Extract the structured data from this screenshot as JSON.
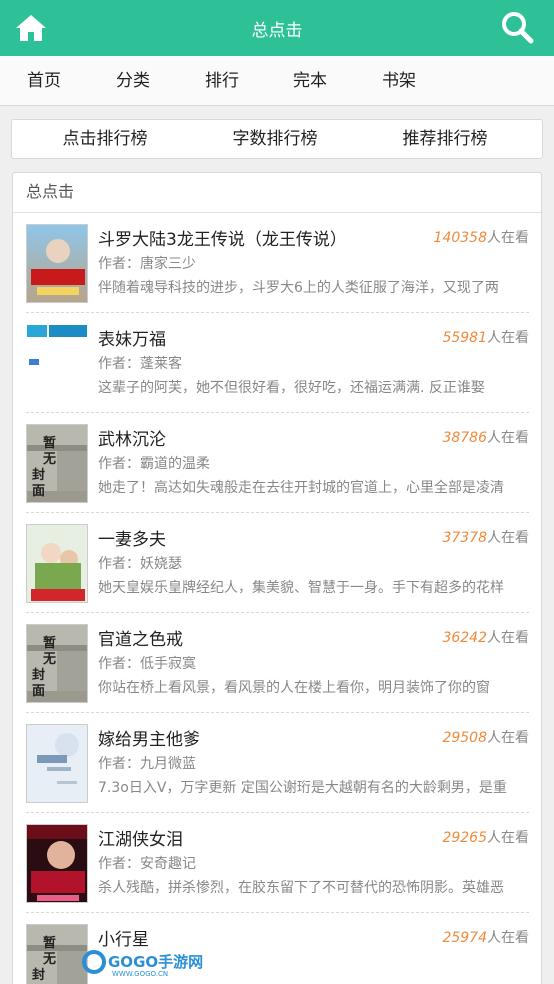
{
  "header": {
    "title": "总点击",
    "theme_color": "#2ec198",
    "home_icon": "home-icon",
    "search_icon": "search-icon"
  },
  "nav": {
    "items": [
      {
        "label": "首页"
      },
      {
        "label": "分类"
      },
      {
        "label": "排行"
      },
      {
        "label": "完本"
      },
      {
        "label": "书架"
      }
    ]
  },
  "rank_tabs": [
    {
      "label": "点击排行榜"
    },
    {
      "label": "字数排行榜"
    },
    {
      "label": "推荐排行榜"
    }
  ],
  "panel": {
    "title": "总点击",
    "views_suffix": "人在看",
    "views_color": "#f08a3b",
    "books": [
      {
        "title": "斗罗大陆3龙王传说（龙王传说）",
        "views": "140358",
        "author": "作者：唐家三少",
        "desc": "伴随着魂导科技的进步，斗罗大6上的人类征服了海洋，又现了两",
        "cover": "cover-douluo"
      },
      {
        "title": "表妹万福",
        "views": "55981",
        "author": "作者：蓬莱客",
        "desc": "这辈子的阿芙，她不但很好看，很好吃，还福运满满. 反正谁娶",
        "cover": "cover-166"
      },
      {
        "title": "武林沉沦",
        "views": "38786",
        "author": "作者：霸道的温柔",
        "desc": "她走了！高达如失魂般走在去往开封城的官道上，心里全部是凌清",
        "cover": "cover-placeholder"
      },
      {
        "title": "一妻多夫",
        "views": "37378",
        "author": "作者：妖娆瑟",
        "desc": "她天皇娱乐皇牌经纪人，集美貌、智慧于一身。手下有超多的花样",
        "cover": "cover-anime"
      },
      {
        "title": "官道之色戒",
        "views": "36242",
        "author": "作者：低手寂寞",
        "desc": "你站在桥上看风景，看风景的人在楼上看你，明月装饰了你的窗",
        "cover": "cover-placeholder"
      },
      {
        "title": "嫁给男主他爹",
        "views": "29508",
        "author": "作者：九月微蓝",
        "desc": "7.3o日入V，万字更新 定国公谢珩是大越朝有名的大龄剩男，是重",
        "cover": "cover-light"
      },
      {
        "title": "江湖侠女泪",
        "views": "29265",
        "author": "作者：安奇趣记",
        "desc": "杀人残酷，拼杀惨烈，在胶东留下了不可替代的恐怖阴影。英雄恶",
        "cover": "cover-red"
      },
      {
        "title": "小行星",
        "views": "25974",
        "author": "",
        "desc": "",
        "cover": "cover-placeholder"
      }
    ]
  },
  "placeholder_cover_text": "暂无封面",
  "watermark": {
    "brand": "GOGO手游网",
    "url": "WWW.GOGO.CN"
  }
}
